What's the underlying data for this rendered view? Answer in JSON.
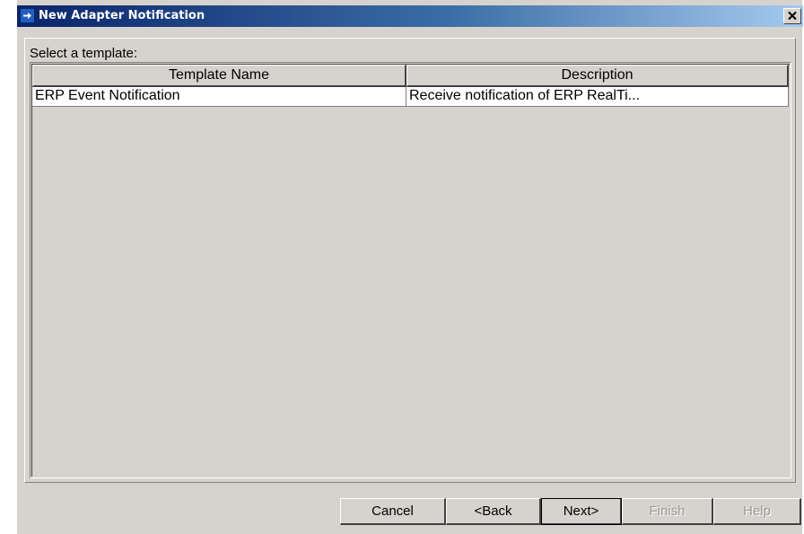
{
  "window": {
    "title": "New Adapter Notification",
    "close_label": "×"
  },
  "main": {
    "select_label": "Select a template:",
    "table": {
      "columns": [
        "Template Name",
        "Description"
      ],
      "rows": [
        {
          "name": "ERP Event Notification",
          "description": "Receive notification of ERP RealTi..."
        }
      ]
    }
  },
  "footer": {
    "cancel_label": "Cancel",
    "back_label": "<Back",
    "next_label": "Next>",
    "finish_label": "Finish",
    "help_label": "Help"
  },
  "icons": {
    "title_icon": "arrow-right-icon",
    "close_icon": "close-icon"
  },
  "colors": {
    "titlebar": "#0a246a",
    "dialog_bg": "#d6d3ce",
    "row_bg": "#ffffff",
    "disabled_text": "#9a9894"
  },
  "state": {
    "finish_enabled": false,
    "help_enabled": false
  }
}
